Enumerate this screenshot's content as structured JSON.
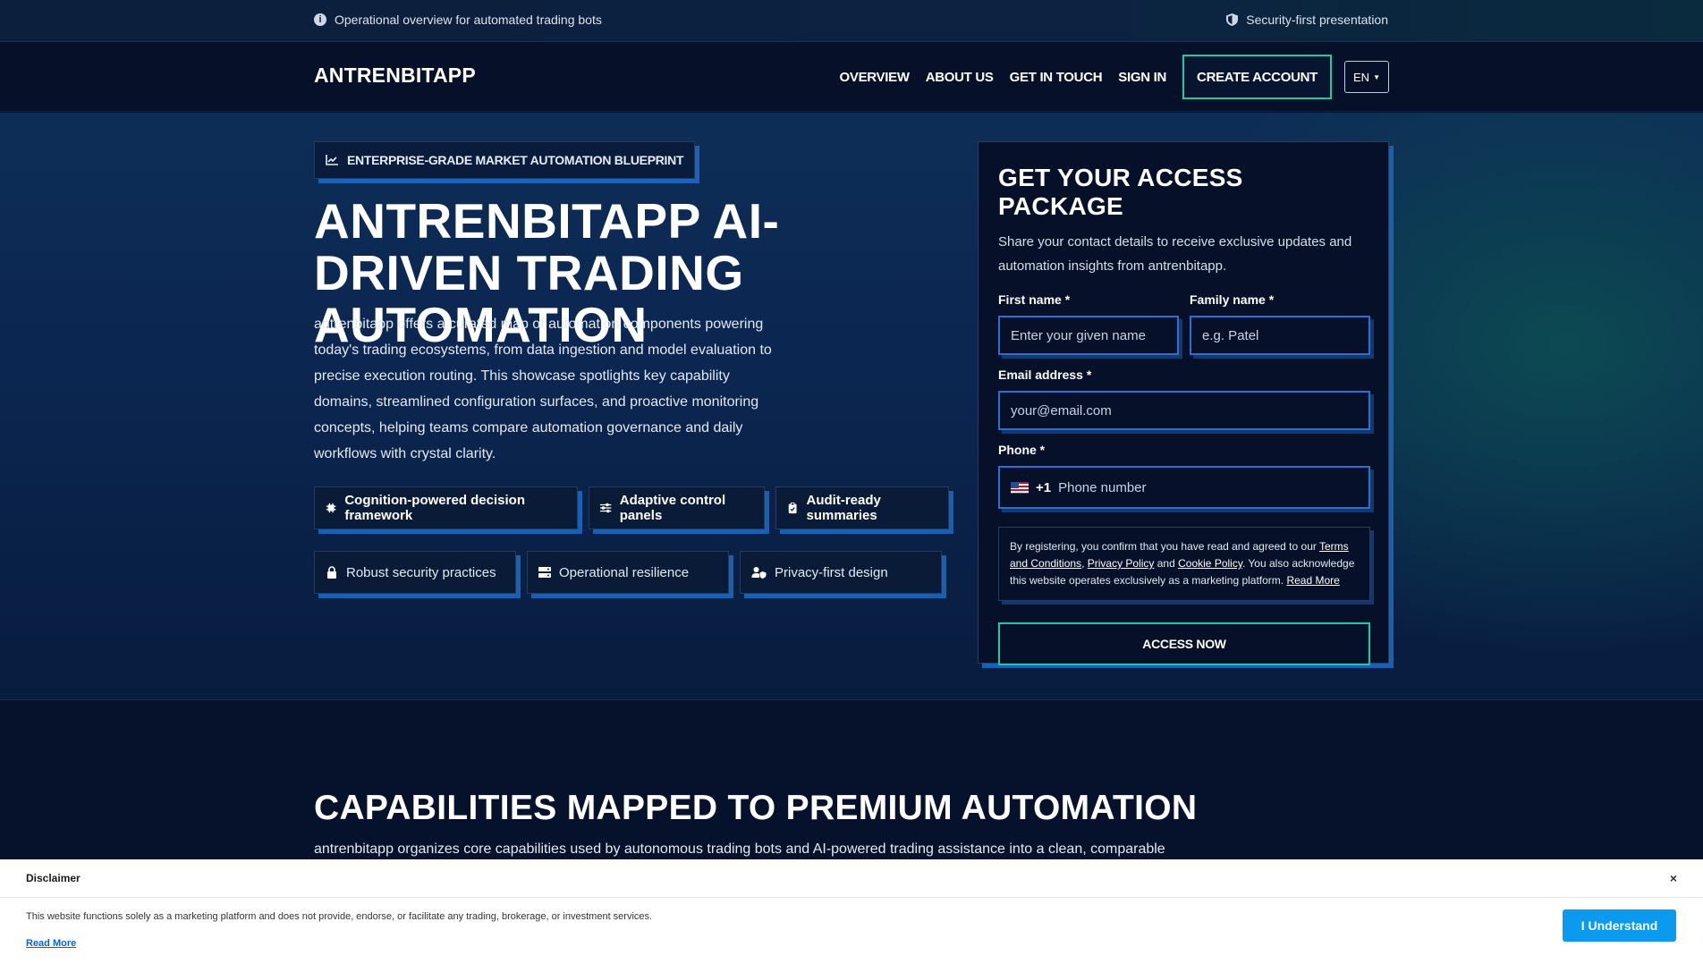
{
  "topbar": {
    "left_text": "Operational overview for automated trading bots",
    "right_text": "Security-first presentation",
    "left_icon": "info-icon",
    "right_icon": "shield-icon"
  },
  "nav": {
    "brand": "ANTRENBITAPP",
    "links": [
      "OVERVIEW",
      "ABOUT US",
      "GET IN TOUCH",
      "SIGN IN"
    ],
    "create_account": "CREATE ACCOUNT",
    "language": "EN"
  },
  "hero": {
    "badge": "ENTERPRISE-GRADE MARKET AUTOMATION BLUEPRINT",
    "badge_icon": "chart-line-icon",
    "title": "ANTRENBITAPP AI-DRIVEN TRADING AUTOMATION",
    "text": "antrenbitapp offers a curated map of automation components powering today's trading ecosystems, from data ingestion and model evaluation to precise execution routing. This showcase spotlights key capability domains, streamlined configuration surfaces, and proactive monitoring concepts, helping teams compare automation governance and daily workflows with crystal clarity.",
    "chips_row1": [
      {
        "label": "Cognition-powered decision framework",
        "icon": "chip-icon"
      },
      {
        "label": "Adaptive control panels",
        "icon": "sliders-icon"
      },
      {
        "label": "Audit-ready summaries",
        "icon": "clipboard-icon"
      }
    ],
    "chips_row2": [
      {
        "label": "Robust security practices",
        "icon": "lock-icon"
      },
      {
        "label": "Operational resilience",
        "icon": "server-icon"
      },
      {
        "label": "Privacy-first design",
        "icon": "user-shield-icon"
      }
    ]
  },
  "form": {
    "title": "GET YOUR ACCESS PACKAGE",
    "subtitle": "Share your contact details to receive exclusive updates and automation insights from antrenbitapp.",
    "first_name_label": "First name *",
    "first_name_placeholder": "Enter your given name",
    "family_name_label": "Family name *",
    "family_name_placeholder": "e.g. Patel",
    "email_label": "Email address *",
    "email_placeholder": "your@email.com",
    "phone_label": "Phone *",
    "phone_code": "+1",
    "phone_placeholder": "Phone number",
    "legal_prefix": "By registering, you confirm that you have read and agreed to our ",
    "legal_terms": "Terms and Conditions",
    "legal_sep1": ", ",
    "legal_privacy": "Privacy Policy",
    "legal_and": " and ",
    "legal_cookie": "Cookie Policy",
    "legal_suffix": ". You also acknowledge this website operates exclusively as a marketing platform. ",
    "legal_read_more": "Read More",
    "submit": "ACCESS NOW"
  },
  "capabilities": {
    "title": "CAPABILITIES MAPPED TO PREMIUM AUTOMATION",
    "text": "antrenbitapp organizes core capabilities used by autonomous trading bots and AI-powered trading assistance into a clean, comparable"
  },
  "disclaimer": {
    "title": "Disclaimer",
    "text": "This website functions solely as a marketing platform and does not provide, endorse, or facilitate any trading, brokerage, or investment services.",
    "read_more": "Read More",
    "button": "I Understand",
    "close": "×"
  },
  "colors": {
    "accent_teal": "#1ec9a6",
    "accent_blue": "#1b5fb0",
    "background": "#06122b",
    "button_blue": "#0b9aee"
  }
}
